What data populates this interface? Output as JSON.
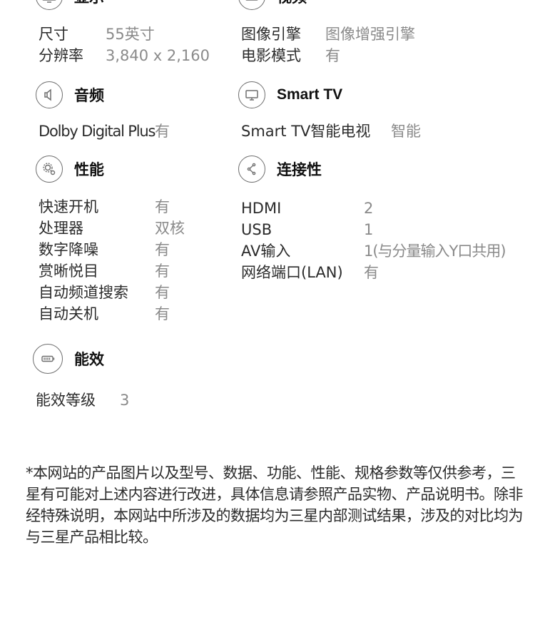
{
  "sections": {
    "display": {
      "title": "显示",
      "icon": "display-icon",
      "specs": [
        {
          "label": "尺寸",
          "value": "55英寸"
        },
        {
          "label": "分辨率",
          "value": "3,840 x 2,160"
        }
      ]
    },
    "video": {
      "title": "视频",
      "icon": "video-icon",
      "specs": [
        {
          "label": "图像引擎",
          "value": "图像增强引擎"
        },
        {
          "label": "电影模式",
          "value": "有"
        }
      ]
    },
    "audio": {
      "title": "音频",
      "icon": "speaker-icon",
      "specs": [
        {
          "label": "Dolby Digital Plus",
          "value": "有"
        }
      ]
    },
    "smart_tv": {
      "title": "Smart TV",
      "icon": "smart-tv-icon",
      "specs": [
        {
          "label": "Smart TV智能电视",
          "value": "智能"
        }
      ]
    },
    "performance": {
      "title": "性能",
      "icon": "gear-icon",
      "specs": [
        {
          "label": "快速开机",
          "value": "有"
        },
        {
          "label": "处理器",
          "value": "双核"
        },
        {
          "label": "数字降噪",
          "value": "有"
        },
        {
          "label": "赏晰悦目",
          "value": "有"
        },
        {
          "label": "自动频道搜索",
          "value": "有"
        },
        {
          "label": "自动关机",
          "value": "有"
        }
      ]
    },
    "connectivity": {
      "title": "连接性",
      "icon": "share-icon",
      "specs": [
        {
          "label": "HDMI",
          "value": "2"
        },
        {
          "label": "USB",
          "value": "1"
        },
        {
          "label": "AV输入",
          "value": "1(与分量输入Y口共用)"
        },
        {
          "label": "网络端口(LAN)",
          "value": "有"
        }
      ]
    },
    "energy": {
      "title": "能效",
      "icon": "battery-icon",
      "specs": [
        {
          "label": "能效等级",
          "value": "3"
        }
      ]
    }
  },
  "footnote": "*本网站的产品图片以及型号、数据、功能、性能、规格参数等仅供参考，三星有可能对上述内容进行改进，具体信息请参照产品实物、产品说明书。除非经特殊说明，本网站中所涉及的数据均为三星内部测试结果，涉及的对比均为与三星产品相比较。"
}
